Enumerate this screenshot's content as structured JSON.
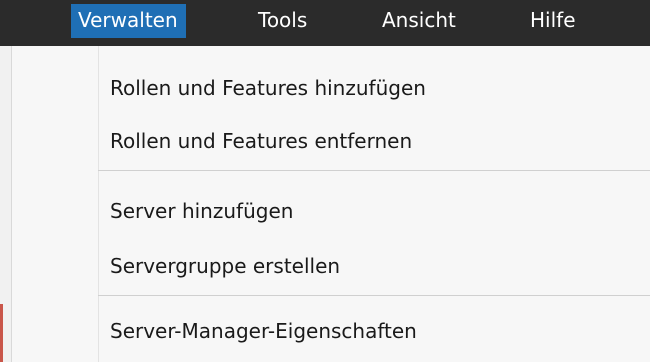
{
  "menubar": {
    "items": [
      {
        "label": "Verwalten",
        "active": true
      },
      {
        "label": "Tools"
      },
      {
        "label": "Ansicht"
      },
      {
        "label": "Hilfe"
      }
    ]
  },
  "dropdown": {
    "groups": [
      [
        "Rollen und Features hinzufügen",
        "Rollen und Features entfernen"
      ],
      [
        "Server hinzufügen",
        "Servergruppe erstellen"
      ],
      [
        "Server-Manager-Eigenschaften"
      ]
    ]
  },
  "colors": {
    "menubar_bg": "#2b2b2b",
    "active_highlight": "#1f6fb5",
    "dropdown_bg": "#f7f7f7",
    "separator": "#d0d0d0"
  }
}
